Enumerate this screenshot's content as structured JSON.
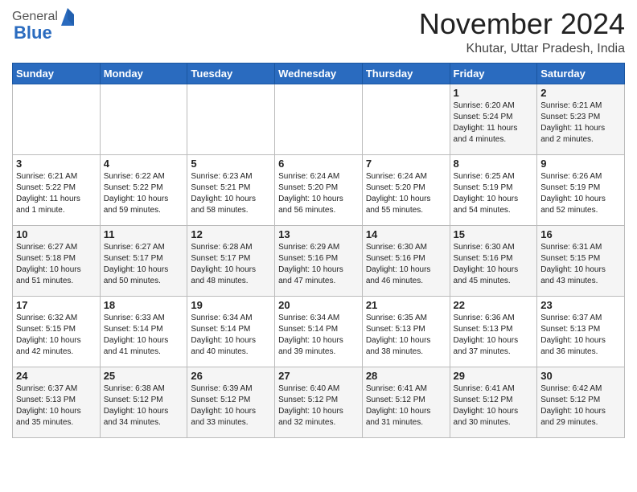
{
  "header": {
    "logo_general": "General",
    "logo_blue": "Blue",
    "month": "November 2024",
    "location": "Khutar, Uttar Pradesh, India"
  },
  "days_of_week": [
    "Sunday",
    "Monday",
    "Tuesday",
    "Wednesday",
    "Thursday",
    "Friday",
    "Saturday"
  ],
  "weeks": [
    [
      {
        "day": "",
        "info": ""
      },
      {
        "day": "",
        "info": ""
      },
      {
        "day": "",
        "info": ""
      },
      {
        "day": "",
        "info": ""
      },
      {
        "day": "",
        "info": ""
      },
      {
        "day": "1",
        "info": "Sunrise: 6:20 AM\nSunset: 5:24 PM\nDaylight: 11 hours\nand 4 minutes."
      },
      {
        "day": "2",
        "info": "Sunrise: 6:21 AM\nSunset: 5:23 PM\nDaylight: 11 hours\nand 2 minutes."
      }
    ],
    [
      {
        "day": "3",
        "info": "Sunrise: 6:21 AM\nSunset: 5:22 PM\nDaylight: 11 hours\nand 1 minute."
      },
      {
        "day": "4",
        "info": "Sunrise: 6:22 AM\nSunset: 5:22 PM\nDaylight: 10 hours\nand 59 minutes."
      },
      {
        "day": "5",
        "info": "Sunrise: 6:23 AM\nSunset: 5:21 PM\nDaylight: 10 hours\nand 58 minutes."
      },
      {
        "day": "6",
        "info": "Sunrise: 6:24 AM\nSunset: 5:20 PM\nDaylight: 10 hours\nand 56 minutes."
      },
      {
        "day": "7",
        "info": "Sunrise: 6:24 AM\nSunset: 5:20 PM\nDaylight: 10 hours\nand 55 minutes."
      },
      {
        "day": "8",
        "info": "Sunrise: 6:25 AM\nSunset: 5:19 PM\nDaylight: 10 hours\nand 54 minutes."
      },
      {
        "day": "9",
        "info": "Sunrise: 6:26 AM\nSunset: 5:19 PM\nDaylight: 10 hours\nand 52 minutes."
      }
    ],
    [
      {
        "day": "10",
        "info": "Sunrise: 6:27 AM\nSunset: 5:18 PM\nDaylight: 10 hours\nand 51 minutes."
      },
      {
        "day": "11",
        "info": "Sunrise: 6:27 AM\nSunset: 5:17 PM\nDaylight: 10 hours\nand 50 minutes."
      },
      {
        "day": "12",
        "info": "Sunrise: 6:28 AM\nSunset: 5:17 PM\nDaylight: 10 hours\nand 48 minutes."
      },
      {
        "day": "13",
        "info": "Sunrise: 6:29 AM\nSunset: 5:16 PM\nDaylight: 10 hours\nand 47 minutes."
      },
      {
        "day": "14",
        "info": "Sunrise: 6:30 AM\nSunset: 5:16 PM\nDaylight: 10 hours\nand 46 minutes."
      },
      {
        "day": "15",
        "info": "Sunrise: 6:30 AM\nSunset: 5:16 PM\nDaylight: 10 hours\nand 45 minutes."
      },
      {
        "day": "16",
        "info": "Sunrise: 6:31 AM\nSunset: 5:15 PM\nDaylight: 10 hours\nand 43 minutes."
      }
    ],
    [
      {
        "day": "17",
        "info": "Sunrise: 6:32 AM\nSunset: 5:15 PM\nDaylight: 10 hours\nand 42 minutes."
      },
      {
        "day": "18",
        "info": "Sunrise: 6:33 AM\nSunset: 5:14 PM\nDaylight: 10 hours\nand 41 minutes."
      },
      {
        "day": "19",
        "info": "Sunrise: 6:34 AM\nSunset: 5:14 PM\nDaylight: 10 hours\nand 40 minutes."
      },
      {
        "day": "20",
        "info": "Sunrise: 6:34 AM\nSunset: 5:14 PM\nDaylight: 10 hours\nand 39 minutes."
      },
      {
        "day": "21",
        "info": "Sunrise: 6:35 AM\nSunset: 5:13 PM\nDaylight: 10 hours\nand 38 minutes."
      },
      {
        "day": "22",
        "info": "Sunrise: 6:36 AM\nSunset: 5:13 PM\nDaylight: 10 hours\nand 37 minutes."
      },
      {
        "day": "23",
        "info": "Sunrise: 6:37 AM\nSunset: 5:13 PM\nDaylight: 10 hours\nand 36 minutes."
      }
    ],
    [
      {
        "day": "24",
        "info": "Sunrise: 6:37 AM\nSunset: 5:13 PM\nDaylight: 10 hours\nand 35 minutes."
      },
      {
        "day": "25",
        "info": "Sunrise: 6:38 AM\nSunset: 5:12 PM\nDaylight: 10 hours\nand 34 minutes."
      },
      {
        "day": "26",
        "info": "Sunrise: 6:39 AM\nSunset: 5:12 PM\nDaylight: 10 hours\nand 33 minutes."
      },
      {
        "day": "27",
        "info": "Sunrise: 6:40 AM\nSunset: 5:12 PM\nDaylight: 10 hours\nand 32 minutes."
      },
      {
        "day": "28",
        "info": "Sunrise: 6:41 AM\nSunset: 5:12 PM\nDaylight: 10 hours\nand 31 minutes."
      },
      {
        "day": "29",
        "info": "Sunrise: 6:41 AM\nSunset: 5:12 PM\nDaylight: 10 hours\nand 30 minutes."
      },
      {
        "day": "30",
        "info": "Sunrise: 6:42 AM\nSunset: 5:12 PM\nDaylight: 10 hours\nand 29 minutes."
      }
    ]
  ]
}
